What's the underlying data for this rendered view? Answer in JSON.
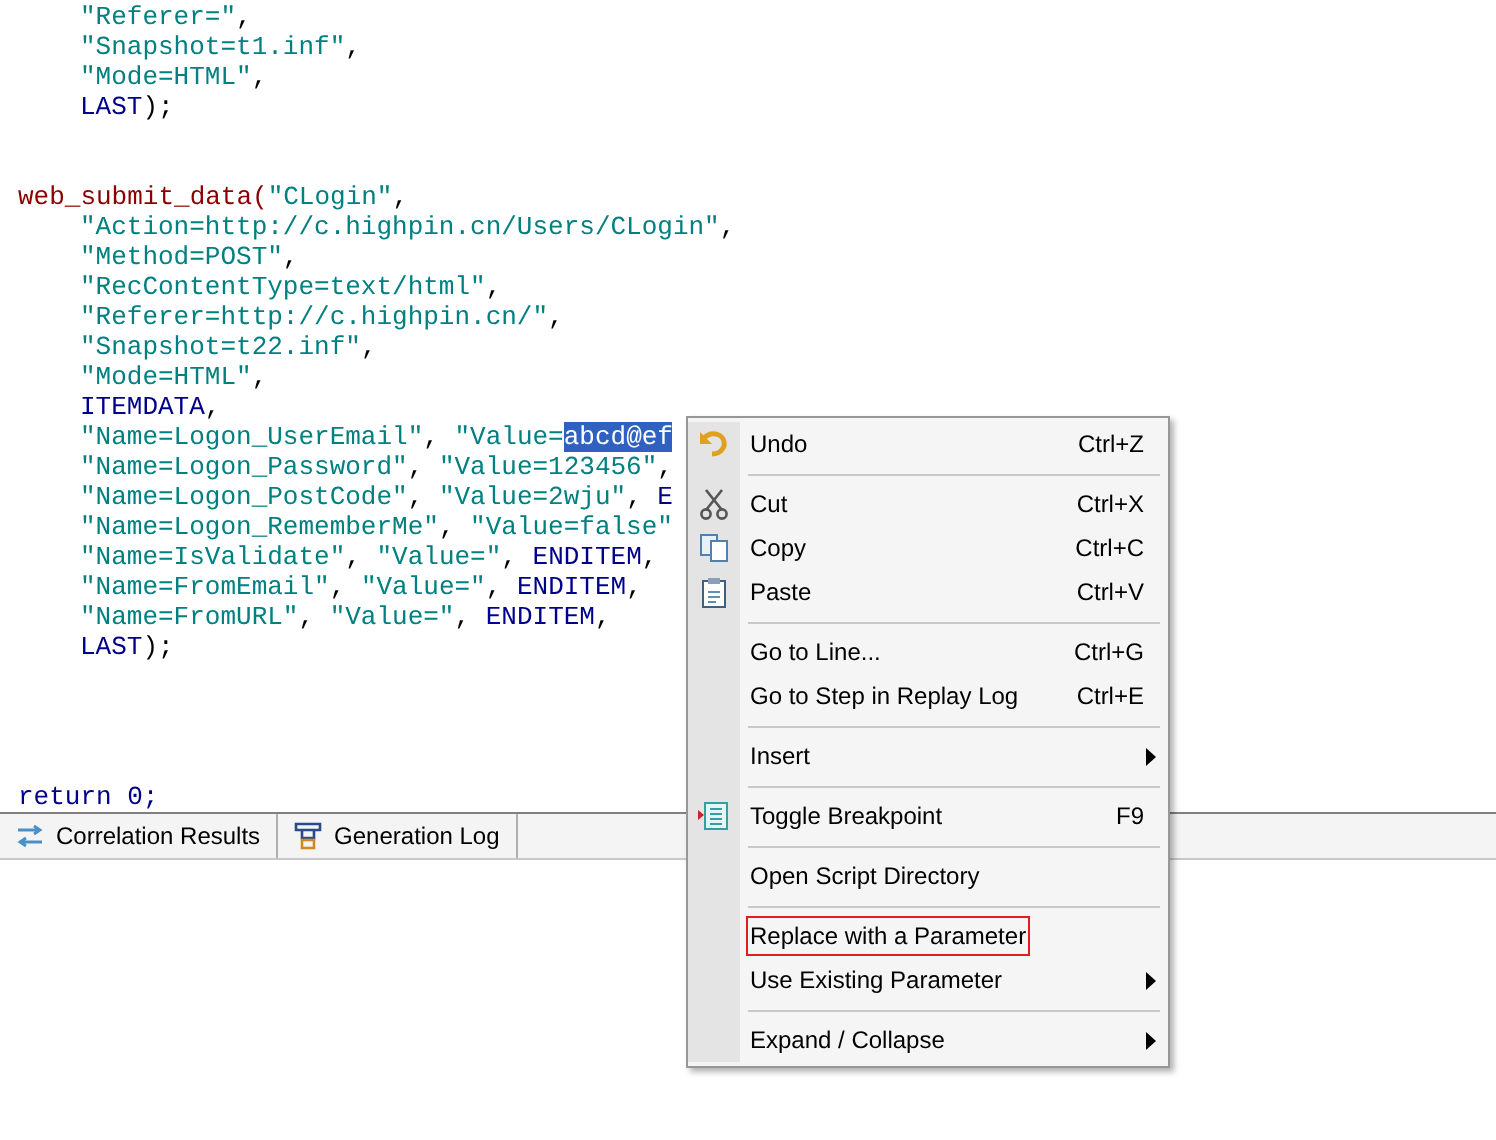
{
  "code_lines": [
    {
      "kind": "code",
      "indent": true,
      "tokens": [
        {
          "kind": "str",
          "text": "\"Referer=\""
        },
        {
          "kind": "plain",
          "text": ","
        }
      ]
    },
    {
      "kind": "code",
      "indent": true,
      "tokens": [
        {
          "kind": "str",
          "text": "\"Snapshot=t1.inf\""
        },
        {
          "kind": "plain",
          "text": ","
        }
      ]
    },
    {
      "kind": "code",
      "indent": true,
      "tokens": [
        {
          "kind": "str",
          "text": "\"Mode=HTML\""
        },
        {
          "kind": "plain",
          "text": ","
        }
      ]
    },
    {
      "kind": "code",
      "indent": true,
      "tokens": [
        {
          "kind": "kw",
          "text": "LAST"
        },
        {
          "kind": "plain",
          "text": ");"
        }
      ]
    },
    {
      "kind": "blank"
    },
    {
      "kind": "blank"
    },
    {
      "kind": "code",
      "indent": false,
      "tokens": [
        {
          "kind": "func",
          "text": "web_submit_data("
        },
        {
          "kind": "str",
          "text": "\"CLogin\""
        },
        {
          "kind": "plain",
          "text": ","
        }
      ]
    },
    {
      "kind": "code",
      "indent": true,
      "tokens": [
        {
          "kind": "str",
          "text": "\"Action=http://c.highpin.cn/Users/CLogin\""
        },
        {
          "kind": "plain",
          "text": ","
        }
      ]
    },
    {
      "kind": "code",
      "indent": true,
      "tokens": [
        {
          "kind": "str",
          "text": "\"Method=POST\""
        },
        {
          "kind": "plain",
          "text": ","
        }
      ]
    },
    {
      "kind": "code",
      "indent": true,
      "tokens": [
        {
          "kind": "str",
          "text": "\"RecContentType=text/html\""
        },
        {
          "kind": "plain",
          "text": ","
        }
      ]
    },
    {
      "kind": "code",
      "indent": true,
      "tokens": [
        {
          "kind": "str",
          "text": "\"Referer=http://c.highpin.cn/\""
        },
        {
          "kind": "plain",
          "text": ","
        }
      ]
    },
    {
      "kind": "code",
      "indent": true,
      "tokens": [
        {
          "kind": "str",
          "text": "\"Snapshot=t22.inf\""
        },
        {
          "kind": "plain",
          "text": ","
        }
      ]
    },
    {
      "kind": "code",
      "indent": true,
      "tokens": [
        {
          "kind": "str",
          "text": "\"Mode=HTML\""
        },
        {
          "kind": "plain",
          "text": ","
        }
      ]
    },
    {
      "kind": "code",
      "indent": true,
      "tokens": [
        {
          "kind": "kw",
          "text": "ITEMDATA"
        },
        {
          "kind": "plain",
          "text": ","
        }
      ]
    },
    {
      "kind": "code",
      "indent": true,
      "tokens": [
        {
          "kind": "str",
          "text": "\"Name=Logon_UserEmail\""
        },
        {
          "kind": "plain",
          "text": ", "
        },
        {
          "kind": "str",
          "text": "\"Value="
        },
        {
          "kind": "sel",
          "text": "abcd@ef"
        }
      ]
    },
    {
      "kind": "code",
      "indent": true,
      "tokens": [
        {
          "kind": "str",
          "text": "\"Name=Logon_Password\""
        },
        {
          "kind": "plain",
          "text": ", "
        },
        {
          "kind": "str",
          "text": "\"Value=123456\""
        },
        {
          "kind": "plain",
          "text": ","
        }
      ]
    },
    {
      "kind": "code",
      "indent": true,
      "tokens": [
        {
          "kind": "str",
          "text": "\"Name=Logon_PostCode\""
        },
        {
          "kind": "plain",
          "text": ", "
        },
        {
          "kind": "str",
          "text": "\"Value=2wju\""
        },
        {
          "kind": "plain",
          "text": ", "
        },
        {
          "kind": "kw",
          "text": "E"
        }
      ]
    },
    {
      "kind": "code",
      "indent": true,
      "tokens": [
        {
          "kind": "str",
          "text": "\"Name=Logon_RememberMe\""
        },
        {
          "kind": "plain",
          "text": ", "
        },
        {
          "kind": "str",
          "text": "\"Value=false\""
        }
      ]
    },
    {
      "kind": "code",
      "indent": true,
      "tokens": [
        {
          "kind": "str",
          "text": "\"Name=IsValidate\""
        },
        {
          "kind": "plain",
          "text": ", "
        },
        {
          "kind": "str",
          "text": "\"Value=\""
        },
        {
          "kind": "plain",
          "text": ", "
        },
        {
          "kind": "kw",
          "text": "ENDITEM"
        },
        {
          "kind": "plain",
          "text": ","
        }
      ]
    },
    {
      "kind": "code",
      "indent": true,
      "tokens": [
        {
          "kind": "str",
          "text": "\"Name=FromEmail\""
        },
        {
          "kind": "plain",
          "text": ", "
        },
        {
          "kind": "str",
          "text": "\"Value=\""
        },
        {
          "kind": "plain",
          "text": ", "
        },
        {
          "kind": "kw",
          "text": "ENDITEM"
        },
        {
          "kind": "plain",
          "text": ","
        }
      ]
    },
    {
      "kind": "code",
      "indent": true,
      "tokens": [
        {
          "kind": "str",
          "text": "\"Name=FromURL\""
        },
        {
          "kind": "plain",
          "text": ", "
        },
        {
          "kind": "str",
          "text": "\"Value=\""
        },
        {
          "kind": "plain",
          "text": ", "
        },
        {
          "kind": "kw",
          "text": "ENDITEM"
        },
        {
          "kind": "plain",
          "text": ","
        }
      ]
    },
    {
      "kind": "code",
      "indent": true,
      "tokens": [
        {
          "kind": "kw",
          "text": "LAST"
        },
        {
          "kind": "plain",
          "text": ");"
        }
      ]
    },
    {
      "kind": "blank"
    },
    {
      "kind": "blank"
    },
    {
      "kind": "blank"
    },
    {
      "kind": "blank"
    },
    {
      "kind": "code",
      "indent": false,
      "tokens": [
        {
          "kind": "kw",
          "text": "return 0;"
        }
      ]
    }
  ],
  "bottom_tabs": [
    {
      "label": "Correlation Results"
    },
    {
      "label": "Generation Log"
    }
  ],
  "context_menu": [
    {
      "kind": "item",
      "label": "Undo",
      "shortcut": "Ctrl+Z",
      "submenu": false,
      "highlighted": false
    },
    {
      "kind": "separator"
    },
    {
      "kind": "item",
      "label": "Cut",
      "shortcut": "Ctrl+X",
      "submenu": false,
      "highlighted": false
    },
    {
      "kind": "item",
      "label": "Copy",
      "shortcut": "Ctrl+C",
      "submenu": false,
      "highlighted": false
    },
    {
      "kind": "item",
      "label": "Paste",
      "shortcut": "Ctrl+V",
      "submenu": false,
      "highlighted": false
    },
    {
      "kind": "separator"
    },
    {
      "kind": "item",
      "label": "Go to Line...",
      "shortcut": "Ctrl+G",
      "submenu": false,
      "highlighted": false
    },
    {
      "kind": "item",
      "label": "Go to Step in Replay Log",
      "shortcut": "Ctrl+E",
      "submenu": false,
      "highlighted": false
    },
    {
      "kind": "separator"
    },
    {
      "kind": "item",
      "label": "Insert",
      "submenu": true,
      "highlighted": false
    },
    {
      "kind": "separator"
    },
    {
      "kind": "item",
      "label": "Toggle Breakpoint",
      "shortcut": "F9",
      "submenu": false,
      "highlighted": false
    },
    {
      "kind": "separator"
    },
    {
      "kind": "item",
      "label": "Open Script Directory",
      "submenu": false,
      "highlighted": false
    },
    {
      "kind": "separator"
    },
    {
      "kind": "item",
      "label": "Replace with a Parameter",
      "submenu": false,
      "highlighted": true
    },
    {
      "kind": "item",
      "label": "Use Existing Parameter",
      "submenu": true,
      "highlighted": false
    },
    {
      "kind": "separator"
    },
    {
      "kind": "item",
      "label": "Expand / Collapse",
      "submenu": true,
      "highlighted": false
    }
  ]
}
